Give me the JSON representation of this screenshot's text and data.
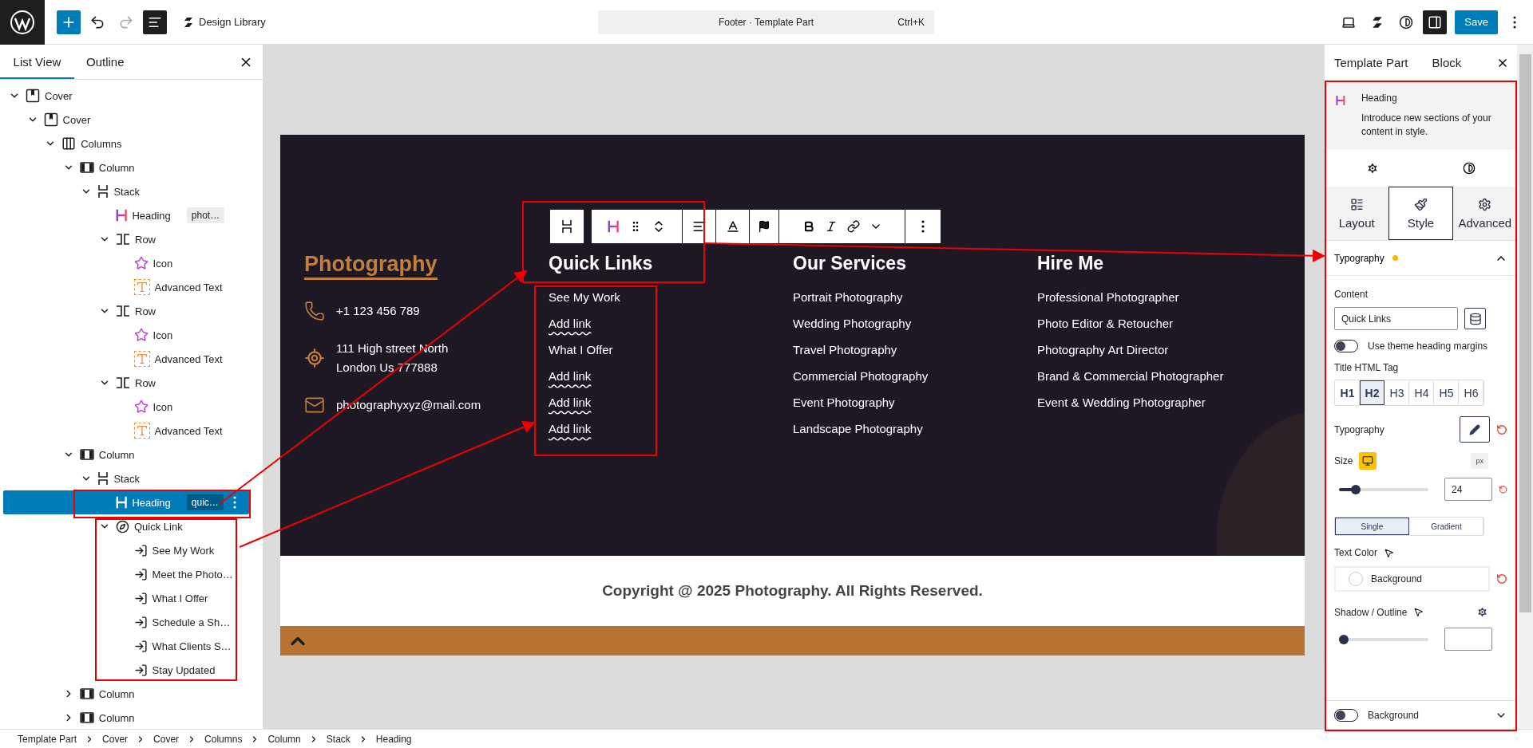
{
  "top_bar": {
    "library": "Design Library",
    "command": {
      "title": "Footer · Template Part",
      "shortcut": "Ctrl+K"
    },
    "save": "Save"
  },
  "left_panel": {
    "tabs": [
      {
        "label": "List View",
        "selected": true
      },
      {
        "label": "Outline",
        "selected": false
      }
    ],
    "tree": [
      {
        "label": "Cover",
        "kind": "cover",
        "expanded": true,
        "selected": false,
        "children": [
          {
            "label": "Cover",
            "kind": "cover",
            "expanded": true,
            "selected": false,
            "children": [
              {
                "label": "Columns",
                "kind": "columns",
                "expanded": true,
                "selected": false,
                "children": [
                  {
                    "label": "Column",
                    "kind": "column",
                    "expanded": true,
                    "selected": false,
                    "children": [
                      {
                        "label": "Stack",
                        "kind": "stack",
                        "expanded": true,
                        "selected": false,
                        "children": [
                          {
                            "label": "Heading",
                            "kind": "heading",
                            "badge": "phot…",
                            "selected": false
                          },
                          {
                            "label": "Row",
                            "kind": "row",
                            "expanded": true,
                            "selected": false,
                            "children": [
                              {
                                "label": "Icon",
                                "kind": "icon",
                                "selected": false
                              },
                              {
                                "label": "Advanced Text",
                                "kind": "text",
                                "selected": false
                              }
                            ]
                          },
                          {
                            "label": "Row",
                            "kind": "row",
                            "expanded": true,
                            "selected": false,
                            "children": [
                              {
                                "label": "Icon",
                                "kind": "icon",
                                "selected": false
                              },
                              {
                                "label": "Advanced Text",
                                "kind": "text",
                                "selected": false
                              }
                            ]
                          },
                          {
                            "label": "Row",
                            "kind": "row",
                            "expanded": true,
                            "selected": false,
                            "children": [
                              {
                                "label": "Icon",
                                "kind": "icon",
                                "selected": false
                              },
                              {
                                "label": "Advanced Text",
                                "kind": "text",
                                "selected": false
                              }
                            ]
                          }
                        ]
                      }
                    ]
                  },
                  {
                    "label": "Column",
                    "kind": "column",
                    "expanded": true,
                    "selected": false,
                    "children": [
                      {
                        "label": "Stack",
                        "kind": "stack",
                        "expanded": true,
                        "selected": false,
                        "children": [
                          {
                            "label": "Heading",
                            "kind": "heading",
                            "badge": "quic…",
                            "selected": true
                          },
                          {
                            "label": "Quick Link",
                            "kind": "quicklink",
                            "expanded": true,
                            "selected": false,
                            "children": [
                              {
                                "label": "See My Work",
                                "kind": "link",
                                "selected": false
                              },
                              {
                                "label": "Meet the Photo…",
                                "kind": "link",
                                "selected": false
                              },
                              {
                                "label": "What I Offer",
                                "kind": "link",
                                "selected": false
                              },
                              {
                                "label": "Schedule a Sh…",
                                "kind": "link",
                                "selected": false
                              },
                              {
                                "label": "What Clients S…",
                                "kind": "link",
                                "selected": false
                              },
                              {
                                "label": "Stay Updated",
                                "kind": "link",
                                "selected": false
                              }
                            ]
                          }
                        ]
                      }
                    ]
                  },
                  {
                    "label": "Column",
                    "kind": "column",
                    "expanded": false,
                    "selected": false
                  },
                  {
                    "label": "Column",
                    "kind": "column",
                    "expanded": false,
                    "selected": false
                  }
                ]
              }
            ]
          }
        ]
      }
    ]
  },
  "canvas": {
    "brand": "Photography",
    "contacts": [
      {
        "kind": "phone",
        "text": "+1 123 456 789"
      },
      {
        "kind": "location",
        "text": "111 High street North\nLondon Us 777888"
      },
      {
        "kind": "mail",
        "text": "photographyxyz@mail.com"
      }
    ],
    "columns": [
      {
        "heading": "Quick Links",
        "links": [
          {
            "kind": "link",
            "text": "See My Work"
          },
          {
            "kind": "placeholder",
            "text": "Add link"
          },
          {
            "kind": "link",
            "text": "What I Offer"
          },
          {
            "kind": "placeholder",
            "text": "Add link"
          },
          {
            "kind": "placeholder",
            "text": "Add link"
          },
          {
            "kind": "placeholder",
            "text": "Add link"
          }
        ]
      },
      {
        "heading": "Our Services",
        "links": [
          {
            "kind": "link",
            "text": "Portrait Photography"
          },
          {
            "kind": "link",
            "text": "Wedding Photography"
          },
          {
            "kind": "link",
            "text": "Travel Photography"
          },
          {
            "kind": "link",
            "text": "Commercial Photography"
          },
          {
            "kind": "link",
            "text": "Event Photography"
          },
          {
            "kind": "link",
            "text": "Landscape Photography"
          }
        ]
      },
      {
        "heading": "Hire Me",
        "links": [
          {
            "kind": "link",
            "text": "Professional Photographer"
          },
          {
            "kind": "link",
            "text": "Photo Editor & Retoucher"
          },
          {
            "kind": "link",
            "text": "Photography Art Director"
          },
          {
            "kind": "link",
            "text": "Brand & Commercial Photographer"
          },
          {
            "kind": "link",
            "text": "Event & Wedding Photographer"
          }
        ]
      }
    ],
    "copyright": "Copyright @ 2025 Photography. All Rights Reserved."
  },
  "right_panel": {
    "tabs": [
      "Template Part",
      "Block"
    ],
    "block": {
      "title": "Heading",
      "description": "Introduce new sections of your content in style."
    },
    "mode_tabs": [
      {
        "label": "Layout",
        "selected": false
      },
      {
        "label": "Style",
        "selected": true
      },
      {
        "label": "Advanced",
        "selected": false
      }
    ],
    "section": {
      "title": "Typography",
      "modified": true,
      "expanded": true
    },
    "content": {
      "label": "Content",
      "value": "Quick Links"
    },
    "theme_margins": {
      "label": "Use theme heading margins",
      "on": false
    },
    "tag": {
      "label": "Title HTML Tag",
      "options": [
        {
          "label": "H1",
          "selected": false
        },
        {
          "label": "H2",
          "selected": true
        },
        {
          "label": "H3",
          "selected": false
        },
        {
          "label": "H4",
          "selected": false
        },
        {
          "label": "H5",
          "selected": false
        },
        {
          "label": "H6",
          "selected": false
        }
      ]
    },
    "typography_label": "Typography",
    "size": {
      "label": "Size",
      "unit": "px",
      "value": "24",
      "level": 0.15
    },
    "color_mode": [
      {
        "label": "Single",
        "selected": true
      },
      {
        "label": "Gradient",
        "selected": false
      }
    ],
    "text_color": {
      "label": "Text Color",
      "value": "Background"
    },
    "shadow": {
      "label": "Shadow / Outline",
      "level": 0
    },
    "background": {
      "label": "Background",
      "on": false
    }
  },
  "breadcrumb": [
    "Template Part",
    "Cover",
    "Cover",
    "Columns",
    "Column",
    "Stack",
    "Heading"
  ]
}
